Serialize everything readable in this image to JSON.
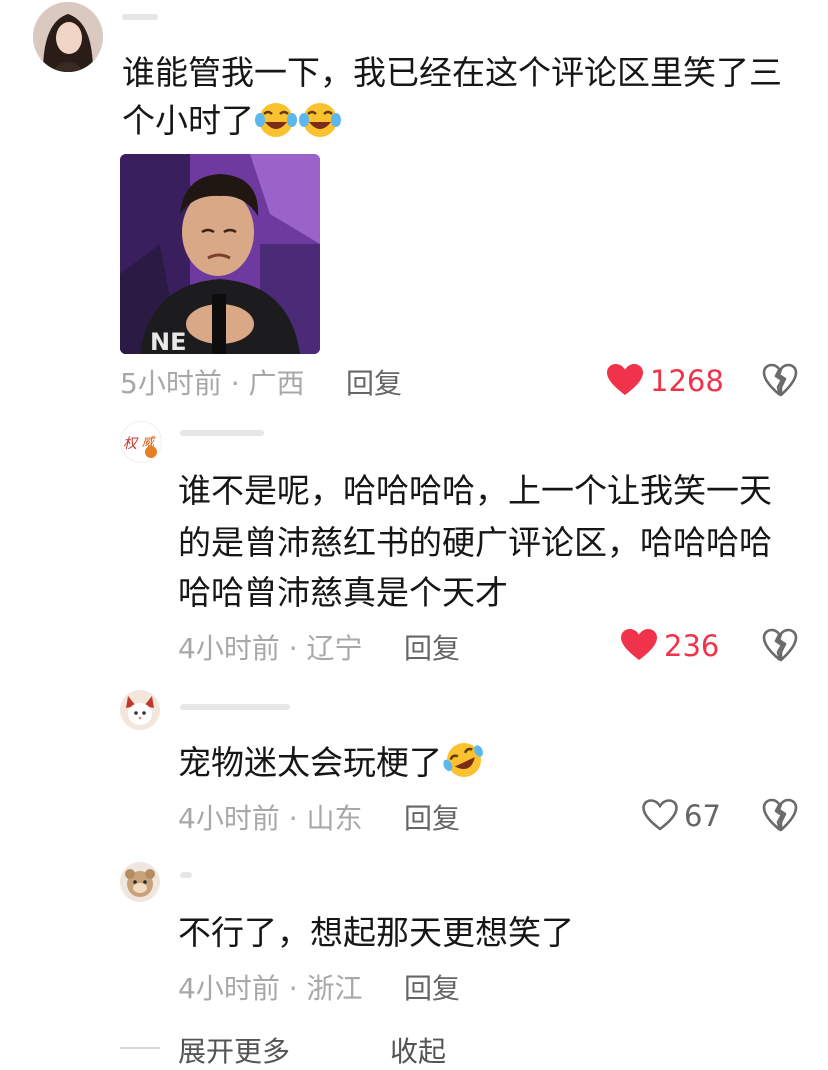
{
  "comments": [
    {
      "text_lines": [
        "谁能管我一下，我已经在这个评论区里笑了三",
        "个小时了"
      ],
      "emojis": [
        "laugh-cry",
        "laugh-cry"
      ],
      "time_location": "5小时前 · 广西",
      "reply_label": "回复",
      "like_count": "1268",
      "liked": true
    },
    {
      "text_lines": [
        "谁不是呢，哈哈哈哈，上一个让我笑一天",
        "的是曾沛慈红书的硬广评论区，哈哈哈哈",
        "哈哈曾沛慈真是个天才"
      ],
      "time_location": "4小时前 · 辽宁",
      "reply_label": "回复",
      "like_count": "236",
      "liked": true
    },
    {
      "text_lines": [
        "宠物迷太会玩梗了"
      ],
      "emojis": [
        "rolling-laugh"
      ],
      "time_location": "4小时前 · 山东",
      "reply_label": "回复",
      "like_count": "67",
      "liked": false
    },
    {
      "text_lines": [
        "不行了，想起那天更想笑了"
      ],
      "time_location": "4小时前 · 浙江",
      "reply_label": "回复"
    }
  ],
  "footer": {
    "expand_more": "展开更多",
    "collapse": "收起"
  },
  "colors": {
    "like_red": "#f0334a",
    "meta_gray": "#a8a8a8",
    "reply_gray": "#666666"
  }
}
